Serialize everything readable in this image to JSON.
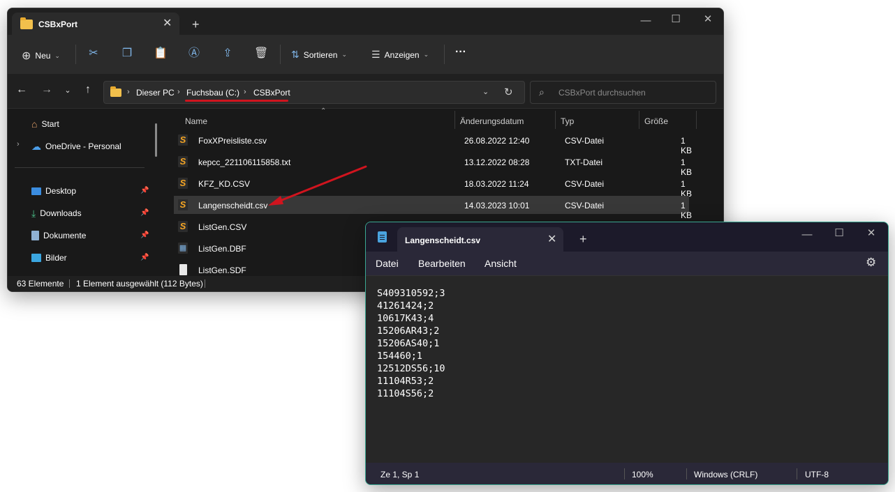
{
  "explorer": {
    "tab_title": "CSBxPort",
    "toolbar": {
      "new_label": "Neu",
      "sort_label": "Sortieren",
      "view_label": "Anzeigen",
      "more_label": "···"
    },
    "address": {
      "crumbs": [
        "Dieser PC",
        "Fuchsbau (C:)",
        "CSBxPort"
      ]
    },
    "search": {
      "placeholder": "CSBxPort durchsuchen"
    },
    "sidebar": {
      "items": [
        {
          "label": "Start",
          "icon": "home-icon"
        },
        {
          "label": "OneDrive - Personal",
          "icon": "cloud-icon"
        },
        {
          "label": "Desktop",
          "icon": "desktop-icon"
        },
        {
          "label": "Downloads",
          "icon": "download-icon"
        },
        {
          "label": "Dokumente",
          "icon": "document-icon"
        },
        {
          "label": "Bilder",
          "icon": "image-icon"
        }
      ]
    },
    "columns": {
      "name": "Name",
      "date": "Änderungsdatum",
      "type": "Typ",
      "size": "Größe"
    },
    "files": [
      {
        "name": "FoxXPreisliste.csv",
        "date": "26.08.2022 12:40",
        "type": "CSV-Datei",
        "size": "1 KB"
      },
      {
        "name": "kepcc_221106115858.txt",
        "date": "13.12.2022 08:28",
        "type": "TXT-Datei",
        "size": "1 KB"
      },
      {
        "name": "KFZ_KD.CSV",
        "date": "18.03.2022 11:24",
        "type": "CSV-Datei",
        "size": "1 KB"
      },
      {
        "name": "Langenscheidt.csv",
        "date": "14.03.2023 10:01",
        "type": "CSV-Datei",
        "size": "1 KB"
      },
      {
        "name": "ListGen.CSV",
        "date": "",
        "type": "",
        "size": ""
      },
      {
        "name": "ListGen.DBF",
        "date": "",
        "type": "",
        "size": ""
      },
      {
        "name": "ListGen.SDF",
        "date": "",
        "type": "",
        "size": ""
      }
    ],
    "status": {
      "count": "63 Elemente",
      "selection": "1 Element ausgewählt (112 Bytes)"
    }
  },
  "notepad": {
    "tab_title": "Langenscheidt.csv",
    "menu": {
      "file": "Datei",
      "edit": "Bearbeiten",
      "view": "Ansicht"
    },
    "lines": [
      "S409310592;3",
      "41261424;2",
      "10617K43;4",
      "15206AR43;2",
      "15206AS40;1",
      "154460;1",
      "12512DS56;10",
      "11104R53;2",
      "11104S56;2"
    ],
    "status": {
      "position": "Ze 1, Sp 1",
      "zoom": "100%",
      "line_ending": "Windows (CRLF)",
      "encoding": "UTF-8"
    }
  },
  "colors": {
    "accent": "#3aa892",
    "annotation": "#d0141e",
    "folder": "#f2c04c"
  }
}
